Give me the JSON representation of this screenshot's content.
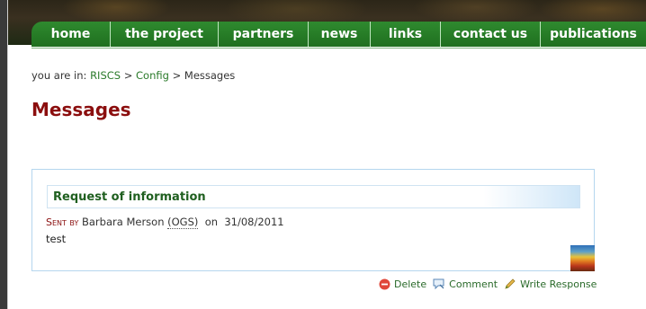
{
  "nav": {
    "items": [
      {
        "label": "home"
      },
      {
        "label": "the project"
      },
      {
        "label": "partners"
      },
      {
        "label": "news"
      },
      {
        "label": "links"
      },
      {
        "label": "contact us"
      },
      {
        "label": "publications"
      }
    ]
  },
  "breadcrumb": {
    "prefix": "you are in:",
    "items": [
      "RISCS",
      "Config",
      "Messages"
    ],
    "separator": ">"
  },
  "page": {
    "title": "Messages"
  },
  "message": {
    "subject": "Request of information",
    "sent_by_label": "Sent by",
    "sender": "Barbara Merson",
    "organization": "(OGS)",
    "date_prefix": "on",
    "date": "31/08/2011",
    "body": "test"
  },
  "actions": {
    "delete": {
      "label": "Delete",
      "icon": "delete-icon",
      "color": "#e0473a"
    },
    "comment": {
      "label": "Comment",
      "icon": "comment-icon"
    },
    "write_response": {
      "label": "Write Response",
      "icon": "pencil-icon"
    }
  },
  "colors": {
    "nav_green": "#1f6f1f",
    "title_red": "#8b0e0e",
    "link_green": "#2a7a2a",
    "box_border": "#b5d6ee"
  }
}
